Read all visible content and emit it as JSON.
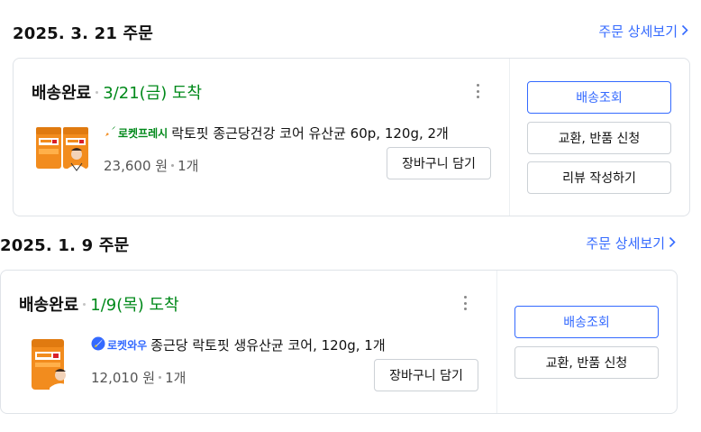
{
  "orders": [
    {
      "date": "2025. 3. 21 주문",
      "detail_link": "주문 상세보기",
      "status": "배송완료",
      "arrival": "3/21(금) 도착",
      "badge": "로켓프레시",
      "product_name": "락토핏 종근당건강 코어 유산균 60p, 120g, 2개",
      "price": "23,600 원",
      "quantity": "1개",
      "cart_button": "장바구니 담기",
      "actions": [
        "배송조회",
        "교환, 반품 신청",
        "리뷰 작성하기"
      ]
    },
    {
      "date": "2025. 1. 9 주문",
      "detail_link": "주문 상세보기",
      "status": "배송완료",
      "arrival": "1/9(목) 도착",
      "badge": "로켓와우",
      "product_name": "종근당 락토핏 생유산균 코어, 120g, 1개",
      "price": "12,010 원",
      "quantity": "1개",
      "cart_button": "장바구니 담기",
      "actions": [
        "배송조회",
        "교환, 반품 신청"
      ]
    }
  ],
  "icons": {
    "chevron": "chevron-right-icon",
    "kebab": "more-vertical-icon",
    "fresh": "rocket-fresh-icon",
    "wow": "rocket-wow-icon"
  },
  "colors": {
    "accent": "#346aff",
    "arrival_green": "#00891a",
    "product_orange": "#f28c1e"
  }
}
